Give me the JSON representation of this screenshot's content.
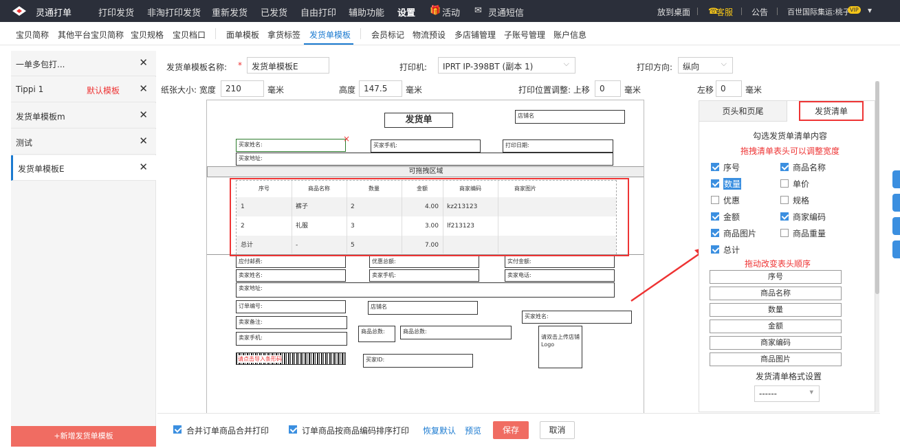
{
  "app": {
    "brand": "灵通打单"
  },
  "topnav": [
    "打印发货",
    "非淘打印发货",
    "重新发货",
    "已发货",
    "自由打印",
    "辅助功能",
    "设置",
    "活动",
    "灵通短信"
  ],
  "topright": {
    "desktop": "放到桌面",
    "service": "客服",
    "notice": "公告",
    "user": "百世国际集运:桃子",
    "badge": "VIP"
  },
  "subnav": [
    "宝贝简称",
    "其他平台宝贝简称",
    "宝贝规格",
    "宝贝档口",
    "面单模板",
    "拿货标签",
    "发货单模板",
    "会员标记",
    "物流预设",
    "多店铺管理",
    "子账号管理",
    "账户信息"
  ],
  "sidebar": {
    "items": [
      {
        "name": "一单多包打...",
        "tag": ""
      },
      {
        "name": "Tippi 1",
        "tag": "默认模板"
      },
      {
        "name": "发货单模板m",
        "tag": ""
      },
      {
        "name": "测试",
        "tag": ""
      },
      {
        "name": "发货单模板E",
        "tag": ""
      }
    ],
    "add_label": "+新增发货单模板"
  },
  "form": {
    "name_label": "发货单模板名称:",
    "name_value": "发货单模板E",
    "printer_label": "打印机:",
    "printer_value": "IPRT IP-398BT (副本 1)",
    "direction_label": "打印方向:",
    "direction_value": "纵向",
    "paper_label": "纸张大小: 宽度",
    "width_value": "210",
    "unit": "毫米",
    "height_label": "高度",
    "height_value": "147.5",
    "offset_label": "打印位置调整: 上移",
    "top_value": "0",
    "left_label": "左移",
    "left_value": "0"
  },
  "canvas": {
    "title": "发货单",
    "shop_name": "店铺名",
    "buyer_name": "买家姓名:",
    "buyer_phone": "买家手机:",
    "print_date": "打印日期:",
    "buyer_addr": "买家地址:",
    "drag_area": "可拖拽区域",
    "table_headers": [
      "序号",
      "商品名称",
      "数量",
      "金额",
      "商家编码",
      "商家图片"
    ],
    "rows": [
      [
        "1",
        "裤子",
        "2",
        "4.00",
        "kz213123",
        ""
      ],
      [
        "2",
        "礼服",
        "3",
        "3.00",
        "lf213123",
        ""
      ],
      [
        "总计",
        "-",
        "5",
        "7.00",
        "",
        ""
      ]
    ],
    "payable": "应付邮费:",
    "discount": "优惠总额:",
    "actual": "实付金额:",
    "seller_name": "卖家姓名:",
    "seller_phone": "卖家手机:",
    "seller_tel": "卖家电话:",
    "seller_addr": "卖家地址:",
    "order_no": "订单编号:",
    "shop_name2": "店铺名",
    "buyer_name2": "买家姓名:",
    "seller_note": "卖家备注:",
    "qty_total": "商品总数:",
    "goods_total": "商品总数:",
    "logo_hint": "请双击上传店铺Logo",
    "seller_phone2": "卖家手机:",
    "barcode_label": "请点击导入条形码",
    "buyer_id": "买家ID:"
  },
  "panel": {
    "tab1": "页头和页尾",
    "tab2": "发货清单",
    "hint1": "勾选发货单清单内容",
    "hint2": "拖拽清单表头可以调整宽度",
    "options": [
      {
        "label": "序号",
        "checked": true
      },
      {
        "label": "商品名称",
        "checked": true
      },
      {
        "label": "数量",
        "checked": true
      },
      {
        "label": "单价",
        "checked": false
      },
      {
        "label": "优惠",
        "checked": false
      },
      {
        "label": "规格",
        "checked": false
      },
      {
        "label": "金额",
        "checked": true
      },
      {
        "label": "商家编码",
        "checked": true
      },
      {
        "label": "商品图片",
        "checked": true
      },
      {
        "label": "商品重量",
        "checked": false
      },
      {
        "label": "总计",
        "checked": true
      }
    ],
    "order_hint": "拖动改变表头顺序",
    "order": [
      "序号",
      "商品名称",
      "数量",
      "金额",
      "商家编码",
      "商品图片"
    ],
    "format_label": "发货清单格式设置",
    "format_value": "------"
  },
  "footer": {
    "merge": "合并订单商品合并打印",
    "sort": "订单商品按商品编码排序打印",
    "reset": "恢复默认",
    "preview": "预览",
    "save": "保存",
    "cancel": "取消"
  },
  "colors": {
    "accent": "#f06c62",
    "link": "#1a7ad0",
    "topbar": "#2b2f3a",
    "highlight": "#e33333"
  }
}
